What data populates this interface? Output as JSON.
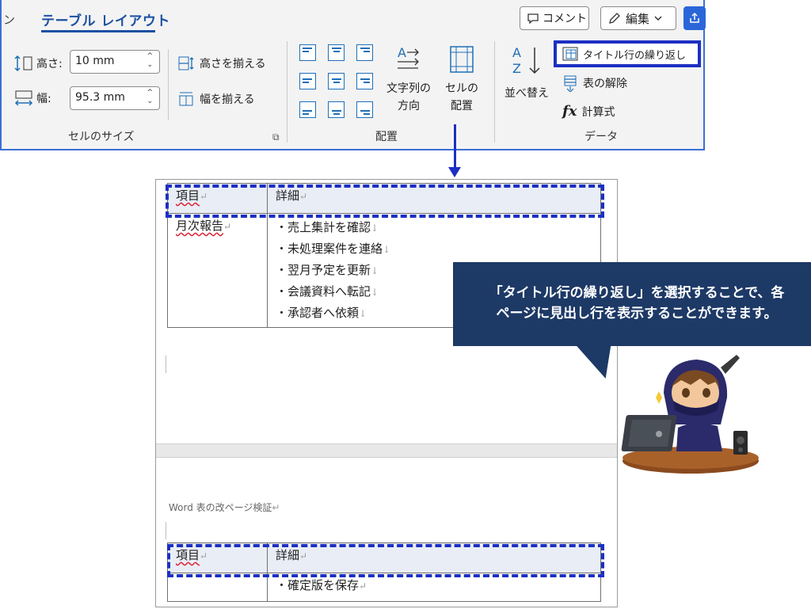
{
  "ribbon": {
    "prev_tab_fragment": "ン",
    "active_tab": "テーブル レイアウト",
    "comment_button": "コメント",
    "edit_button": "編集",
    "cell_size": {
      "height_label": "高さ:",
      "height_value": "10 mm",
      "width_label": "幅:",
      "width_value": "95.3 mm",
      "distribute_rows": "高さを揃える",
      "distribute_cols": "幅を揃える",
      "group_label": "セルのサイズ"
    },
    "alignment": {
      "text_direction_line1": "文字列の",
      "text_direction_line2": "方向",
      "cell_margins_line1": "セルの",
      "cell_margins_line2": "配置",
      "group_label": "配置"
    },
    "data": {
      "sort_label": "並べ替え",
      "repeat_header": "タイトル行の繰り返し",
      "convert_to_text": "表の解除",
      "formula": "計算式",
      "group_label": "データ"
    }
  },
  "document": {
    "page1_table": {
      "header": [
        "項目",
        "詳細"
      ],
      "row_label": "月次報告",
      "items": [
        "・売上集計を確認",
        "・未処理案件を連絡",
        "・翌月予定を更新",
        "・会議資料へ転記",
        "・承認者へ依頼"
      ]
    },
    "page2_note": "Word 表の改ページ検証",
    "page2_table": {
      "header": [
        "項目",
        "詳細"
      ],
      "items": [
        "・確定版を保存"
      ]
    }
  },
  "callout": {
    "line1": "「タイトル行の繰り返し」を選択することで、各",
    "line2": "ページに見出し行を表示することができます。"
  },
  "colors": {
    "accent_blue": "#1c2fc2",
    "tab_blue": "#1c50a3",
    "callout_navy": "#1d3966",
    "header_fill": "#e9edf6"
  }
}
